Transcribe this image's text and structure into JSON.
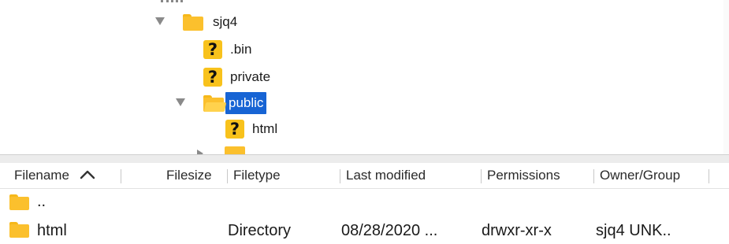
{
  "tree": {
    "nodes": [
      {
        "label": "sjq4",
        "icon": "folder-icon",
        "expanded": true
      },
      {
        "label": ".bin",
        "icon": "unknown-question-icon"
      },
      {
        "label": "private",
        "icon": "unknown-question-icon"
      },
      {
        "label": "public",
        "icon": "folder-open-icon",
        "expanded": true,
        "selected": true
      },
      {
        "label": "html",
        "icon": "unknown-question-icon"
      }
    ],
    "selection_color": "#1764d4",
    "folder_color": "#fbc02d",
    "question_color": "#f8c21c"
  },
  "table": {
    "columns": [
      {
        "label": "Filename",
        "sorted": "ascending"
      },
      {
        "label": "Filesize"
      },
      {
        "label": "Filetype"
      },
      {
        "label": "Last modified"
      },
      {
        "label": "Permissions"
      },
      {
        "label": "Owner/Group"
      }
    ],
    "rows": [
      {
        "filename": "..",
        "filesize": "",
        "filetype": "",
        "last_modified": "",
        "permissions": "",
        "owner_group": ""
      },
      {
        "filename": "html",
        "filesize": "",
        "filetype": "Directory",
        "last_modified": "08/28/2020 ...",
        "permissions": "drwxr-xr-x",
        "owner_group": "sjq4 UNK.."
      }
    ]
  }
}
